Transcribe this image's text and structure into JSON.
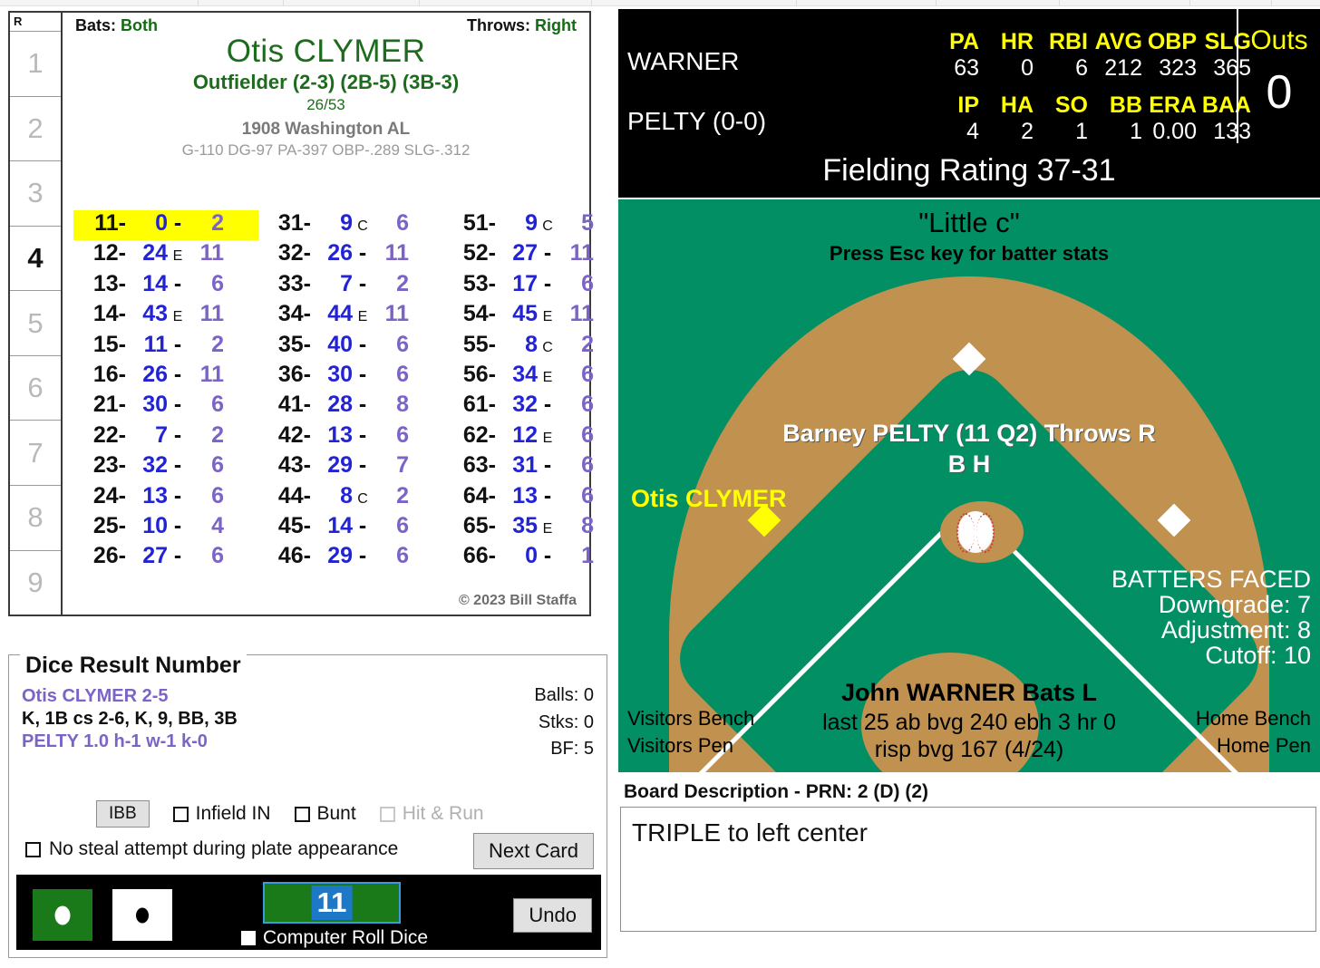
{
  "innings": {
    "header": "R",
    "list": [
      "1",
      "2",
      "3",
      "4",
      "5",
      "6",
      "7",
      "8",
      "9"
    ],
    "active": "4"
  },
  "card": {
    "bats_label": "Bats:",
    "bats_value": "Both",
    "throws_label": "Throws:",
    "throws_value": "Right",
    "player_name": "Otis CLYMER",
    "position": "Outfielder (2-3) (2B-5) (3B-3)",
    "fraction": "26/53",
    "team": "1908 Washington AL",
    "stats": "G-110 DG-97 PA-397 OBP-.289 SLG-.312",
    "copyright": "© 2023 Bill Staffa",
    "columns": [
      [
        {
          "key": "11-",
          "a": "0",
          "mark": "-",
          "b": "2",
          "hl": true
        },
        {
          "key": "12-",
          "a": "24",
          "mark": "E",
          "b": "11",
          "hl": false
        },
        {
          "key": "13-",
          "a": "14",
          "mark": "-",
          "b": "6",
          "hl": false
        },
        {
          "key": "14-",
          "a": "43",
          "mark": "E",
          "b": "11",
          "hl": false
        },
        {
          "key": "15-",
          "a": "11",
          "mark": "-",
          "b": "2",
          "hl": false
        },
        {
          "key": "16-",
          "a": "26",
          "mark": "-",
          "b": "11",
          "hl": false
        },
        {
          "key": "21-",
          "a": "30",
          "mark": "-",
          "b": "6",
          "hl": false
        },
        {
          "key": "22-",
          "a": "7",
          "mark": "-",
          "b": "2",
          "hl": false
        },
        {
          "key": "23-",
          "a": "32",
          "mark": "-",
          "b": "6",
          "hl": false
        },
        {
          "key": "24-",
          "a": "13",
          "mark": "-",
          "b": "6",
          "hl": false
        },
        {
          "key": "25-",
          "a": "10",
          "mark": "-",
          "b": "4",
          "hl": false
        },
        {
          "key": "26-",
          "a": "27",
          "mark": "-",
          "b": "6",
          "hl": false
        }
      ],
      [
        {
          "key": "31-",
          "a": "9",
          "mark": "C",
          "b": "6",
          "hl": false
        },
        {
          "key": "32-",
          "a": "26",
          "mark": "-",
          "b": "11",
          "hl": false
        },
        {
          "key": "33-",
          "a": "7",
          "mark": "-",
          "b": "2",
          "hl": false
        },
        {
          "key": "34-",
          "a": "44",
          "mark": "E",
          "b": "11",
          "hl": false
        },
        {
          "key": "35-",
          "a": "40",
          "mark": "-",
          "b": "6",
          "hl": false
        },
        {
          "key": "36-",
          "a": "30",
          "mark": "-",
          "b": "6",
          "hl": false
        },
        {
          "key": "41-",
          "a": "28",
          "mark": "-",
          "b": "8",
          "hl": false
        },
        {
          "key": "42-",
          "a": "13",
          "mark": "-",
          "b": "6",
          "hl": false
        },
        {
          "key": "43-",
          "a": "29",
          "mark": "-",
          "b": "7",
          "hl": false
        },
        {
          "key": "44-",
          "a": "8",
          "mark": "C",
          "b": "2",
          "hl": false
        },
        {
          "key": "45-",
          "a": "14",
          "mark": "-",
          "b": "6",
          "hl": false
        },
        {
          "key": "46-",
          "a": "29",
          "mark": "-",
          "b": "6",
          "hl": false
        }
      ],
      [
        {
          "key": "51-",
          "a": "9",
          "mark": "C",
          "b": "5",
          "hl": false
        },
        {
          "key": "52-",
          "a": "27",
          "mark": "-",
          "b": "11",
          "hl": false
        },
        {
          "key": "53-",
          "a": "17",
          "mark": "-",
          "b": "6",
          "hl": false
        },
        {
          "key": "54-",
          "a": "45",
          "mark": "E",
          "b": "11",
          "hl": false
        },
        {
          "key": "55-",
          "a": "8",
          "mark": "C",
          "b": "2",
          "hl": false
        },
        {
          "key": "56-",
          "a": "34",
          "mark": "E",
          "b": "6",
          "hl": false
        },
        {
          "key": "61-",
          "a": "32",
          "mark": "-",
          "b": "6",
          "hl": false
        },
        {
          "key": "62-",
          "a": "12",
          "mark": "E",
          "b": "6",
          "hl": false
        },
        {
          "key": "63-",
          "a": "31",
          "mark": "-",
          "b": "6",
          "hl": false
        },
        {
          "key": "64-",
          "a": "13",
          "mark": "-",
          "b": "6",
          "hl": false
        },
        {
          "key": "65-",
          "a": "35",
          "mark": "E",
          "b": "8",
          "hl": false
        },
        {
          "key": "66-",
          "a": "0",
          "mark": "-",
          "b": "1",
          "hl": false
        }
      ]
    ]
  },
  "dice_panel": {
    "legend": "Dice Result Number",
    "line1": "Otis CLYMER  2-5",
    "line2": "K, 1B cs 2-6, K, 9, BB, 3B",
    "line3": "PELTY 1.0 h-1 w-1 k-0",
    "balls": "Balls: 0",
    "strikes": "Stks: 0",
    "bf": "BF: 5",
    "ibb_label": "IBB",
    "infield_in": "Infield IN",
    "bunt": "Bunt",
    "hit_and_run": "Hit & Run",
    "no_steal": "No steal attempt during plate appearance",
    "next_card": "Next Card",
    "roll_value": "11",
    "computer_roll": "Computer Roll Dice",
    "undo": "Undo"
  },
  "scoreboard": {
    "batter_name": "WARNER",
    "pitcher_name": "PELTY (0-0)",
    "batter_headers": [
      "PA",
      "HR",
      "RBI",
      "AVG",
      "OBP",
      "SLG"
    ],
    "batter_values": [
      "63",
      "0",
      "6",
      "212",
      "323",
      "365"
    ],
    "pitcher_headers": [
      "IP",
      "HA",
      "SO",
      "BB",
      "ERA",
      "BAA"
    ],
    "pitcher_values": [
      "4",
      "2",
      "1",
      "1",
      "0.00",
      "133"
    ],
    "outs_label": "Outs",
    "outs_value": "0"
  },
  "fielding": {
    "rating": "Fielding Rating 37-31",
    "little_c": "\"Little c\"",
    "esc_hint": "Press Esc key for batter stats",
    "pitcher_line": "Barney PELTY (11 Q2) Throws R",
    "bh_line": "B H",
    "runner_third": "Otis CLYMER",
    "batters_faced": "BATTERS FACED",
    "downgrade": "Downgrade: 7",
    "adjustment": "Adjustment: 8",
    "cutoff": "Cutoff: 10",
    "batter_line": "John WARNER Bats L",
    "last_line": "last 25 ab bvg 240 ebh 3 hr 0",
    "risp_line": "risp bvg 167 (4/24)",
    "visitors_bench": "Visitors Bench",
    "visitors_pen": "Visitors Pen",
    "home_bench": "Home Bench",
    "home_pen": "Home Pen"
  },
  "board": {
    "label": "Board Description - PRN: 2 (D) (2)",
    "text": "TRIPLE to left center"
  },
  "colors": {
    "field_green": "#018f63",
    "dirt": "#c0914f",
    "card_green": "#1d6b1d",
    "blue": "#2323d6",
    "purple": "#7b63c8",
    "highlight": "#ffff00"
  }
}
